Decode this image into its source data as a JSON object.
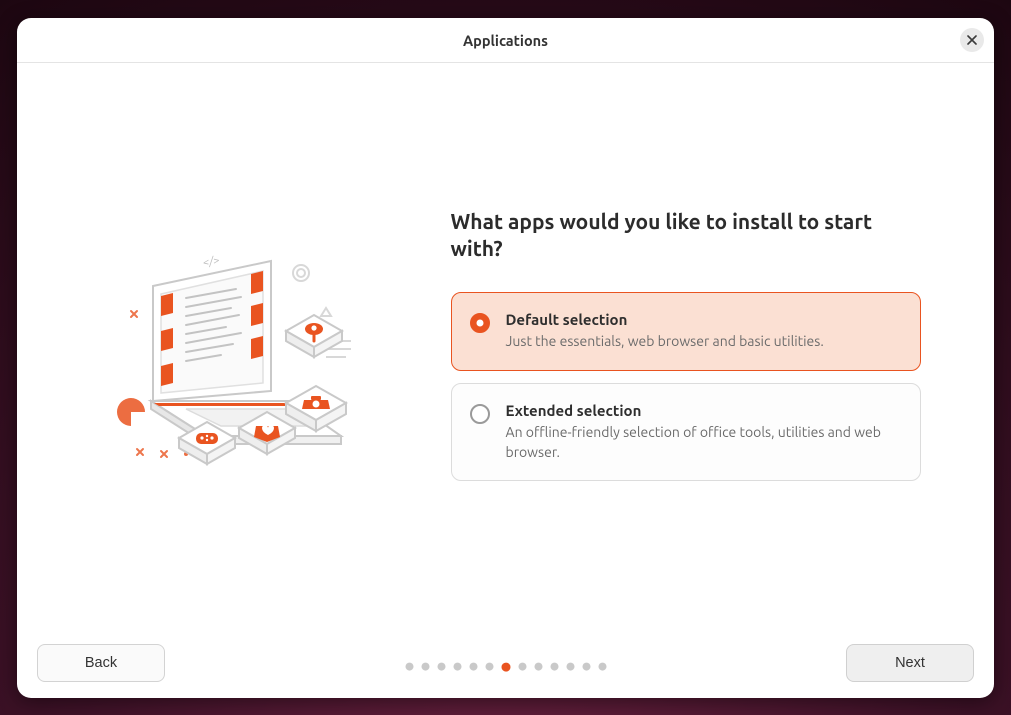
{
  "colors": {
    "accent": "#e95420"
  },
  "titlebar": {
    "title": "Applications"
  },
  "main": {
    "heading": "What apps would you like to install to start with?",
    "options": [
      {
        "id": "default",
        "title": "Default selection",
        "description": "Just the essentials, web browser and basic utilities.",
        "selected": true
      },
      {
        "id": "extended",
        "title": "Extended selection",
        "description": "An offline-friendly selection of office tools, utilities and web browser.",
        "selected": false
      }
    ]
  },
  "footer": {
    "back_label": "Back",
    "next_label": "Next",
    "pager": {
      "total": 13,
      "current_index": 6
    }
  },
  "illustration": {
    "semantic": "laptop-apps-illustration"
  }
}
